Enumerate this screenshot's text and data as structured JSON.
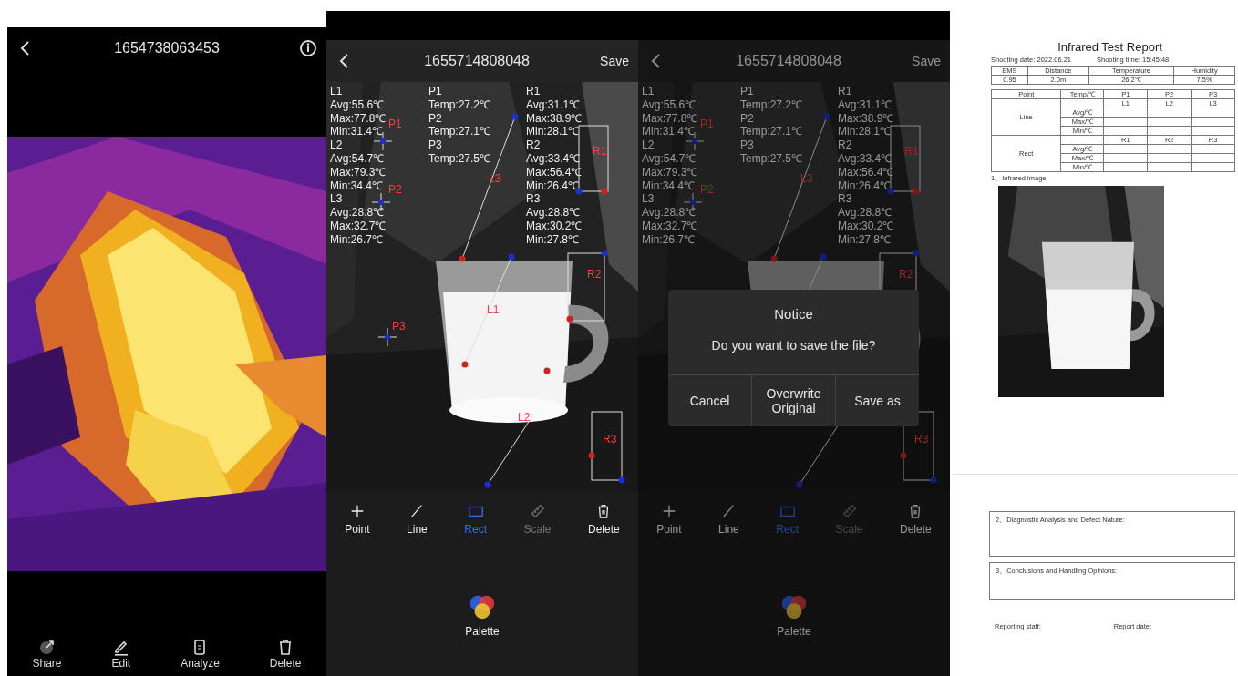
{
  "panels": [
    {
      "kind": "viewer",
      "title": "1654738063453",
      "actions": [
        {
          "kind": "share",
          "label": "Share"
        },
        {
          "kind": "edit",
          "label": "Edit"
        },
        {
          "kind": "analyze",
          "label": "Analyze"
        },
        {
          "kind": "delete",
          "label": "Delete"
        }
      ]
    },
    {
      "kind": "analysis",
      "title": "1655714808048",
      "save": "Save",
      "readings": [
        [
          {
            "name": "L1",
            "lines": [
              "Avg:55.6℃",
              "Max:77.8℃",
              "Min:31.4℃"
            ]
          },
          {
            "name": "L2",
            "lines": [
              "Avg:54.7℃",
              "Max:79.3℃",
              "Min:34.4℃"
            ]
          },
          {
            "name": "L3",
            "lines": [
              "Avg:28.8℃",
              "Max:32.7℃",
              "Min:26.7℃"
            ]
          }
        ],
        [
          {
            "name": "P1",
            "lines": [
              "Temp:27.2℃"
            ]
          },
          {
            "name": "P2",
            "lines": [
              "Temp:27.1℃"
            ]
          },
          {
            "name": "P3",
            "lines": [
              "Temp:27.5℃"
            ]
          }
        ],
        [
          {
            "name": "R1",
            "lines": [
              "Avg:31.1℃",
              "Max:38.9℃",
              "Min:28.1℃"
            ]
          },
          {
            "name": "R2",
            "lines": [
              "Avg:33.4℃",
              "Max:56.4℃",
              "Min:26.4℃"
            ]
          },
          {
            "name": "R3",
            "lines": [
              "Avg:28.8℃",
              "Max:30.2℃",
              "Min:27.8℃"
            ]
          }
        ]
      ],
      "markers": [
        "P1",
        "P2",
        "P3",
        "L3",
        "L1",
        "L2",
        "R1",
        "R2",
        "R3"
      ],
      "tools": [
        {
          "kind": "point",
          "label": "Point",
          "selected": false,
          "disabled": false
        },
        {
          "kind": "line",
          "label": "Line",
          "selected": false,
          "disabled": false
        },
        {
          "kind": "rect",
          "label": "Rect",
          "selected": true,
          "disabled": false
        },
        {
          "kind": "scale",
          "label": "Scale",
          "selected": false,
          "disabled": true
        },
        {
          "kind": "delete",
          "label": "Delete",
          "selected": false,
          "disabled": false
        }
      ],
      "palette": "Palette"
    },
    {
      "kind": "analysis",
      "title": "1655714808048",
      "save": "Save",
      "readings": [
        [
          {
            "name": "L1",
            "lines": [
              "Avg:55.6℃",
              "Max:77.8℃",
              "Min:31.4℃"
            ]
          },
          {
            "name": "L2",
            "lines": [
              "Avg:54.7℃",
              "Max:79.3℃",
              "Min:34.4℃"
            ]
          },
          {
            "name": "L3",
            "lines": [
              "Avg:28.8℃",
              "Max:32.7℃",
              "Min:26.7℃"
            ]
          }
        ],
        [
          {
            "name": "P1",
            "lines": [
              "Temp:27.2℃"
            ]
          },
          {
            "name": "P2",
            "lines": [
              "Temp:27.1℃"
            ]
          },
          {
            "name": "P3",
            "lines": [
              "Temp:27.5℃"
            ]
          }
        ],
        [
          {
            "name": "R1",
            "lines": [
              "Avg:31.1℃",
              "Max:38.9℃",
              "Min:28.1℃"
            ]
          },
          {
            "name": "R2",
            "lines": [
              "Avg:33.4℃",
              "Max:56.4℃",
              "Min:26.4℃"
            ]
          },
          {
            "name": "R3",
            "lines": [
              "Avg:28.8℃",
              "Max:30.2℃",
              "Min:27.8℃"
            ]
          }
        ]
      ],
      "markers": [
        "P1",
        "P2",
        "L3",
        "R1",
        "R2",
        "R3"
      ],
      "tools": [
        {
          "kind": "point",
          "label": "Point",
          "selected": false,
          "disabled": false
        },
        {
          "kind": "line",
          "label": "Line",
          "selected": false,
          "disabled": false
        },
        {
          "kind": "rect",
          "label": "Rect",
          "selected": true,
          "disabled": false
        },
        {
          "kind": "scale",
          "label": "Scale",
          "selected": false,
          "disabled": true
        },
        {
          "kind": "delete",
          "label": "Delete",
          "selected": false,
          "disabled": false
        }
      ],
      "palette": "Palette",
      "dialog": {
        "title": "Notice",
        "message": "Do you want to save the file?",
        "buttons": [
          "Cancel",
          "Overwrite Original",
          "Save as"
        ]
      }
    },
    {
      "kind": "report",
      "title": "Infrared Test Report",
      "meta": [
        "Shooting date: 2022.06.21",
        "Shooting time: 15:45:48"
      ],
      "conditions": {
        "columns": [
          "EMS",
          "Distance",
          "Temperature",
          "Humidity"
        ],
        "values": [
          "0.95",
          "2.0m",
          "26.2℃",
          "7.5%"
        ]
      },
      "sections": [
        {
          "name": "Point",
          "label": "Temp/℃",
          "items": [
            "P1",
            "P2",
            "P3"
          ]
        },
        {
          "name": "Line",
          "items": [
            "L1",
            "L2",
            "L3"
          ],
          "rows": [
            "Avg/℃",
            "Max/℃",
            "Min/℃"
          ]
        },
        {
          "name": "Rect",
          "items": [
            "R1",
            "R2",
            "R3"
          ],
          "rows": [
            "Avg/℃",
            "Max/℃",
            "Min/℃"
          ]
        }
      ],
      "image_caption": "1、Infrared image",
      "boxes": [
        "2、Diagnostic Analysis and Defect Nature:",
        "3、Conclusions and Handling Opinions:"
      ],
      "footer": [
        "Reporting staff:",
        "Report date:"
      ]
    }
  ]
}
